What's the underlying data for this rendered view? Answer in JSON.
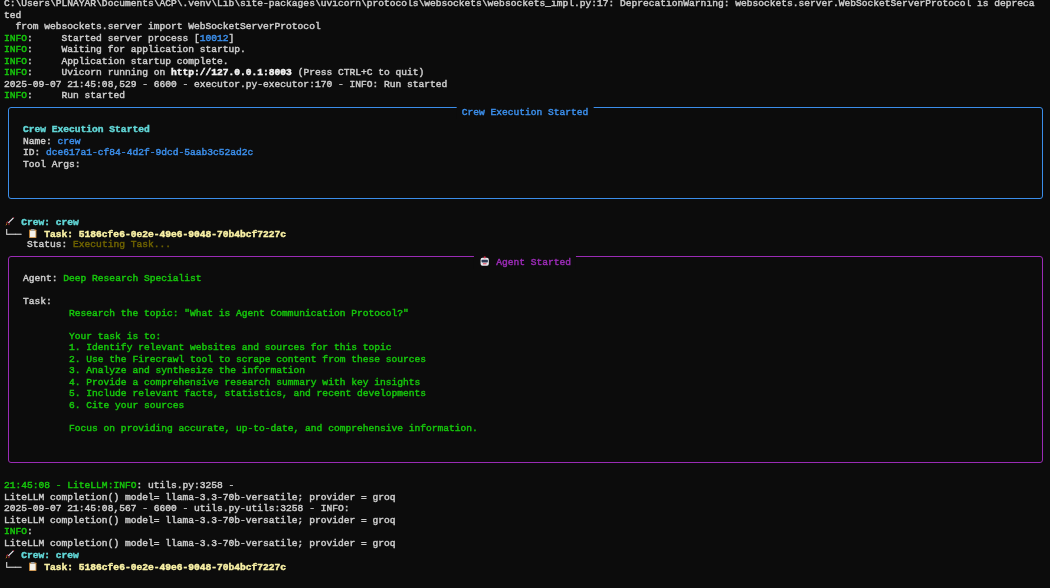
{
  "terminal": {
    "blocks": [
      {
        "kind": "line",
        "segments": [
          {
            "kind": "text",
            "text": "C:\\Users\\PLNAYAR\\Documents\\ACP\\.venv\\Lib\\site-packages\\uvicorn\\protocols\\websockets\\websockets_impl.py:17: DeprecationWarning: websockets.server.WebSocketServerProtocol is depreca"
          }
        ]
      },
      {
        "kind": "line",
        "segments": [
          {
            "kind": "text",
            "text": "ted"
          }
        ]
      },
      {
        "kind": "line",
        "segments": [
          {
            "kind": "text",
            "text": "  from websockets.server import WebSocketServerProtocol"
          }
        ]
      },
      {
        "kind": "line",
        "segments": [
          {
            "kind": "text",
            "color": "#16c60c",
            "text": "INFO"
          },
          {
            "kind": "text",
            "text": ":     Started server process ["
          },
          {
            "kind": "text",
            "color": "#3b8eea",
            "text": "10012"
          },
          {
            "kind": "text",
            "text": "]"
          }
        ]
      },
      {
        "kind": "line",
        "segments": [
          {
            "kind": "text",
            "color": "#16c60c",
            "text": "INFO"
          },
          {
            "kind": "text",
            "text": ":     Waiting for application startup."
          }
        ]
      },
      {
        "kind": "line",
        "segments": [
          {
            "kind": "text",
            "color": "#16c60c",
            "text": "INFO"
          },
          {
            "kind": "text",
            "text": ":     Application startup complete."
          }
        ]
      },
      {
        "kind": "line",
        "segments": [
          {
            "kind": "text",
            "color": "#16c60c",
            "text": "INFO"
          },
          {
            "kind": "text",
            "text": ":     Uvicorn running on "
          },
          {
            "kind": "text",
            "color": "#f2f2f2",
            "bold": true,
            "text": "http://127.0.0.1:8003"
          },
          {
            "kind": "text",
            "text": " (Press CTRL+C to quit)"
          }
        ]
      },
      {
        "kind": "line",
        "segments": [
          {
            "kind": "text",
            "text": "2025-09-07 21:45:08,529 - 6600 - executor.py-executor:170 - INFO: Run started"
          }
        ]
      },
      {
        "kind": "line",
        "segments": [
          {
            "kind": "text",
            "color": "#16c60c",
            "text": "INFO"
          },
          {
            "kind": "text",
            "text": ":     Run started"
          }
        ]
      },
      {
        "kind": "panel",
        "color": "#3b8eea",
        "title": [
          {
            "kind": "text",
            "color": "#3b8eea",
            "text": "Crew Execution Started"
          }
        ],
        "lines": [
          {
            "kind": "blank"
          },
          {
            "kind": "line",
            "segments": [
              {
                "kind": "text",
                "color": "#61d6d6",
                "bold": true,
                "text": "Crew Execution Started"
              }
            ]
          },
          {
            "kind": "line",
            "segments": [
              {
                "kind": "text",
                "text": "Name: "
              },
              {
                "kind": "text",
                "color": "#3b8eea",
                "text": "crew"
              }
            ]
          },
          {
            "kind": "line",
            "segments": [
              {
                "kind": "text",
                "text": "ID: "
              },
              {
                "kind": "text",
                "color": "#3b8eea",
                "text": "dce617a1-cf84-4d2f-9dcd-5aab3c52ad2c"
              }
            ]
          },
          {
            "kind": "line",
            "segments": [
              {
                "kind": "text",
                "text": "Tool Args:"
              }
            ]
          },
          {
            "kind": "blank"
          },
          {
            "kind": "blank"
          }
        ]
      },
      {
        "kind": "blank"
      },
      {
        "kind": "line",
        "segments": [
          {
            "kind": "rocket-icon"
          },
          {
            "kind": "text",
            "color": "#61d6d6",
            "bold": true,
            "text": " Crew: crew"
          }
        ]
      },
      {
        "kind": "line",
        "segments": [
          {
            "kind": "text",
            "text": "└── "
          },
          {
            "kind": "clipboard-icon"
          },
          {
            "kind": "text",
            "color": "#f9f1a5",
            "bold": true,
            "text": " Task: 5186cfe6-0e2e-49e6-9048-70b4bcf7227c"
          }
        ]
      },
      {
        "kind": "line",
        "segments": [
          {
            "kind": "text",
            "text": "    Status: "
          },
          {
            "kind": "text",
            "color": "#6e6200",
            "text": "Executing Task..."
          }
        ]
      },
      {
        "kind": "panel",
        "color": "#9a2bb5",
        "title": [
          {
            "kind": "robot-icon"
          },
          {
            "kind": "text",
            "color": "#9a2bb5",
            "text": " Agent Started"
          }
        ],
        "lines": [
          {
            "kind": "blank"
          },
          {
            "kind": "line",
            "segments": [
              {
                "kind": "text",
                "text": "Agent: "
              },
              {
                "kind": "text",
                "color": "#16c60c",
                "text": "Deep Research Specialist"
              }
            ]
          },
          {
            "kind": "blank"
          },
          {
            "kind": "line",
            "segments": [
              {
                "kind": "text",
                "text": "Task:"
              }
            ]
          },
          {
            "kind": "line",
            "segments": [
              {
                "kind": "text",
                "color": "#16c60c",
                "text": "        Research the topic: \"What is Agent Communication Protocol?\""
              }
            ]
          },
          {
            "kind": "blank"
          },
          {
            "kind": "line",
            "segments": [
              {
                "kind": "text",
                "color": "#16c60c",
                "text": "        Your task is to:"
              }
            ]
          },
          {
            "kind": "line",
            "segments": [
              {
                "kind": "text",
                "color": "#16c60c",
                "text": "        1. Identify relevant websites and sources for this topic"
              }
            ]
          },
          {
            "kind": "line",
            "segments": [
              {
                "kind": "text",
                "color": "#16c60c",
                "text": "        2. Use the Firecrawl tool to scrape content from these sources"
              }
            ]
          },
          {
            "kind": "line",
            "segments": [
              {
                "kind": "text",
                "color": "#16c60c",
                "text": "        3. Analyze and synthesize the information"
              }
            ]
          },
          {
            "kind": "line",
            "segments": [
              {
                "kind": "text",
                "color": "#16c60c",
                "text": "        4. Provide a comprehensive research summary with key insights"
              }
            ]
          },
          {
            "kind": "line",
            "segments": [
              {
                "kind": "text",
                "color": "#16c60c",
                "text": "        5. Include relevant facts, statistics, and recent developments"
              }
            ]
          },
          {
            "kind": "line",
            "segments": [
              {
                "kind": "text",
                "color": "#16c60c",
                "text": "        6. Cite your sources"
              }
            ]
          },
          {
            "kind": "blank"
          },
          {
            "kind": "line",
            "segments": [
              {
                "kind": "text",
                "color": "#16c60c",
                "text": "        Focus on providing accurate, up-to-date, and comprehensive information."
              }
            ]
          },
          {
            "kind": "blank"
          },
          {
            "kind": "blank"
          }
        ]
      },
      {
        "kind": "blank"
      },
      {
        "kind": "line",
        "segments": [
          {
            "kind": "text",
            "color": "#16c60c",
            "text": "21:45:08 - LiteLLM:INFO"
          },
          {
            "kind": "text",
            "text": ": utils.py:3258 - "
          }
        ]
      },
      {
        "kind": "line",
        "segments": [
          {
            "kind": "text",
            "text": "LiteLLM completion() model= llama-3.3-70b-versatile; provider = groq"
          }
        ]
      },
      {
        "kind": "line",
        "segments": [
          {
            "kind": "text",
            "text": "2025-09-07 21:45:08,567 - 6600 - utils.py-utils:3258 - INFO: "
          }
        ]
      },
      {
        "kind": "line",
        "segments": [
          {
            "kind": "text",
            "text": "LiteLLM completion() model= llama-3.3-70b-versatile; provider = groq"
          }
        ]
      },
      {
        "kind": "line",
        "segments": [
          {
            "kind": "text",
            "color": "#16c60c",
            "text": "INFO"
          },
          {
            "kind": "text",
            "text": ":"
          }
        ]
      },
      {
        "kind": "line",
        "segments": [
          {
            "kind": "text",
            "text": "LiteLLM completion() model= llama-3.3-70b-versatile; provider = groq"
          }
        ]
      },
      {
        "kind": "line",
        "segments": [
          {
            "kind": "rocket-icon"
          },
          {
            "kind": "text",
            "color": "#61d6d6",
            "bold": true,
            "text": " Crew: crew"
          }
        ]
      },
      {
        "kind": "line",
        "segments": [
          {
            "kind": "text",
            "text": "└── "
          },
          {
            "kind": "clipboard-icon"
          },
          {
            "kind": "text",
            "color": "#f9f1a5",
            "bold": true,
            "text": " Task: 5186cfe6-0e2e-49e6-9048-70b4bcf7227c"
          }
        ]
      }
    ]
  }
}
